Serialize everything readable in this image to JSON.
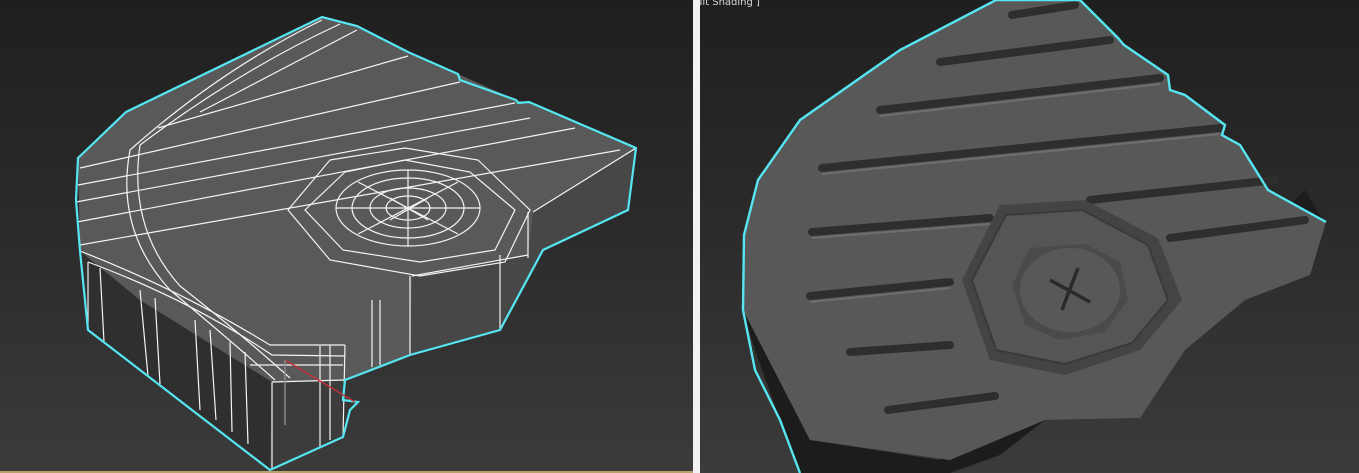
{
  "viewports": {
    "left": {
      "mode": "wireframe"
    },
    "right": {
      "label": "ult Shading ]",
      "mode": "default-shading"
    }
  },
  "colors": {
    "selection_outline": "#55e6f2",
    "wire": "#f4f4f4",
    "surface_top": "#555555",
    "surface_side": "#2b2b2b",
    "axis_x": "#c0303c",
    "axis_y": "#8a8a8a"
  },
  "icons": [
    "gizmo-axis-icon"
  ]
}
